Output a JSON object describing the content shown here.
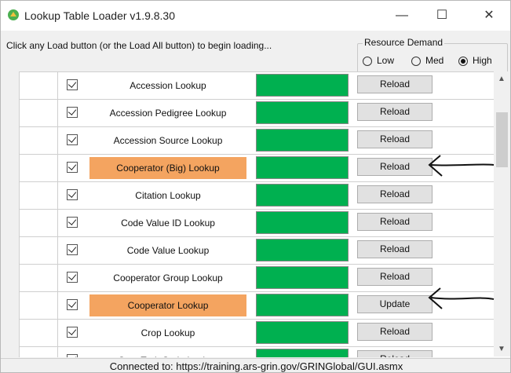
{
  "window": {
    "title": "Lookup Table Loader v1.9.8.30",
    "minimize": "—",
    "maximize": "☐",
    "close": "✕"
  },
  "message": "Click any Load button (or the Load All button) to begin loading...",
  "resource_demand": {
    "legend": "Resource Demand",
    "options": [
      {
        "label": "Low",
        "selected": false
      },
      {
        "label": "Med",
        "selected": false
      },
      {
        "label": "High",
        "selected": true
      }
    ]
  },
  "rows": [
    {
      "label": "Accession Lookup",
      "button": "Reload",
      "highlight": false,
      "checked": true
    },
    {
      "label": "Accession Pedigree Lookup",
      "button": "Reload",
      "highlight": false,
      "checked": true
    },
    {
      "label": "Accession Source Lookup",
      "button": "Reload",
      "highlight": false,
      "checked": true
    },
    {
      "label": "Cooperator (Big) Lookup",
      "button": "Reload",
      "highlight": true,
      "checked": true
    },
    {
      "label": "Citation Lookup",
      "button": "Reload",
      "highlight": false,
      "checked": true
    },
    {
      "label": "Code Value ID Lookup",
      "button": "Reload",
      "highlight": false,
      "checked": true
    },
    {
      "label": "Code Value Lookup",
      "button": "Reload",
      "highlight": false,
      "checked": true
    },
    {
      "label": "Cooperator Group Lookup",
      "button": "Reload",
      "highlight": false,
      "checked": true
    },
    {
      "label": "Cooperator Lookup",
      "button": "Update",
      "highlight": true,
      "checked": true
    },
    {
      "label": "Crop Lookup",
      "button": "Reload",
      "highlight": false,
      "checked": true
    },
    {
      "label": "Crop Trait Code Lookup",
      "button": "Reload",
      "highlight": false,
      "checked": true
    }
  ],
  "status": "Connected to: https://training.ars-grin.gov/GRINGlobal/GUI.asmx",
  "colors": {
    "progress": "#00b050",
    "highlight": "#f4a460"
  }
}
